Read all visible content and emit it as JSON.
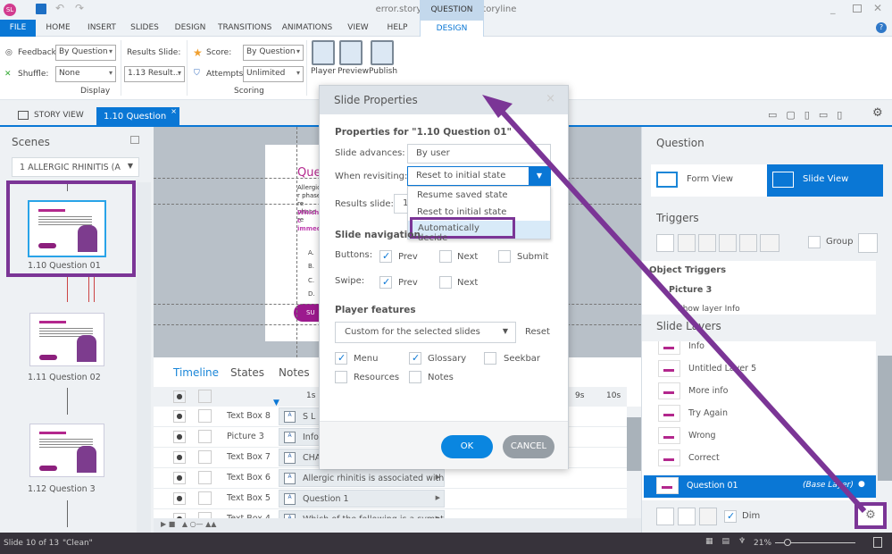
{
  "app": {
    "logo": "SL",
    "title": "error.story -  Articulate Storyline",
    "context_tab": "QUESTION TOOLS"
  },
  "ribbon_tabs": [
    "FILE",
    "HOME",
    "INSERT",
    "SLIDES",
    "DESIGN",
    "TRANSITIONS",
    "ANIMATIONS",
    "VIEW",
    "HELP",
    "DESIGN"
  ],
  "ribbon": {
    "feedback_label": "Feedback:",
    "feedback_value": "By Question",
    "shuffle_label": "Shuffle:",
    "shuffle_value": "None",
    "results_label": "Results Slide:",
    "results_value": "1.13 Result...",
    "display_group": "Display",
    "score_label": "Score:",
    "score_value": "By Question",
    "attempts_label": "Attempts:",
    "attempts_value": "Unlimited",
    "scoring_group": "Scoring",
    "player": "Player",
    "preview": "Preview",
    "publish": "Publish"
  },
  "doc_tabs": {
    "story_view": "STORY VIEW",
    "active": "1.10 Question ..."
  },
  "scenes": {
    "title": "Scenes",
    "scene_select": "1 ALLERGIC RHINITIS (A",
    "slides": [
      "1.10 Question 01",
      "1.11 Question 02",
      "1.12 Question 3"
    ]
  },
  "slide_preview": {
    "heading": "Ques",
    "body": "Allergic r phase re phase re",
    "question": "Which c immedi",
    "options": [
      "A.",
      "B.",
      "C.",
      "D."
    ],
    "submit": "SU"
  },
  "timeline": {
    "tabs": [
      "Timeline",
      "States",
      "Notes"
    ],
    "ticks": [
      "1s",
      "9s",
      "10s"
    ],
    "rows": [
      {
        "name": "Text Box 8",
        "bar": "S L I"
      },
      {
        "name": "Picture 3",
        "bar": "Info"
      },
      {
        "name": "Text Box 7",
        "bar": "CHA"
      },
      {
        "name": "Text Box 6",
        "bar": "Allergic rhinitis is associated with ..."
      },
      {
        "name": "Text Box 5",
        "bar": "Question 1"
      },
      {
        "name": "Text Box 4",
        "bar": "Which of the following is a sympt..."
      }
    ]
  },
  "dialog": {
    "title": "Slide Properties",
    "properties_for": "Properties for \"1.10 Question 01\"",
    "slide_advances_label": "Slide advances:",
    "slide_advances_value": "By user",
    "revisiting_label": "When revisiting:",
    "revisiting_value": "Reset to initial state",
    "revisiting_options": [
      "Resume saved state",
      "Reset to initial state",
      "Automatically decide"
    ],
    "results_label": "Results slide:",
    "results_value": "1",
    "nav_title": "Slide navigation",
    "buttons_label": "Buttons:",
    "buttons": [
      {
        "label": "Prev",
        "checked": true
      },
      {
        "label": "Next",
        "checked": false
      },
      {
        "label": "Submit",
        "checked": false
      }
    ],
    "swipe_label": "Swipe:",
    "swipe": [
      {
        "label": "Prev",
        "checked": true
      },
      {
        "label": "Next",
        "checked": false
      }
    ],
    "player_title": "Player features",
    "player_value": "Custom for the selected slides",
    "reset": "Reset",
    "features": [
      {
        "label": "Menu",
        "checked": true
      },
      {
        "label": "Glossary",
        "checked": true
      },
      {
        "label": "Seekbar",
        "checked": false
      },
      {
        "label": "Resources",
        "checked": false
      },
      {
        "label": "Notes",
        "checked": false
      }
    ],
    "ok": "OK",
    "cancel": "CANCEL"
  },
  "right": {
    "question_title": "Question",
    "form_view": "Form View",
    "slide_view": "Slide View",
    "triggers_title": "Triggers",
    "group": "Group",
    "object_triggers": "Object Triggers",
    "picture": "Picture 3",
    "trigger_action": "Show layer Info",
    "layers_title": "Slide Layers",
    "layers": [
      "Info",
      "Untitled Layer 5",
      "More info",
      "Try Again",
      "Wrong",
      "Correct"
    ],
    "base_layer": "Question 01",
    "base_tag": "(Base Layer)",
    "dim": "Dim"
  },
  "status": {
    "slide": "Slide 10 of 13",
    "theme": "\"Clean\"",
    "zoom": "21%"
  },
  "colors": {
    "accent": "#0a77d5",
    "annotation": "#7b3596",
    "brand": "#b3278d"
  }
}
